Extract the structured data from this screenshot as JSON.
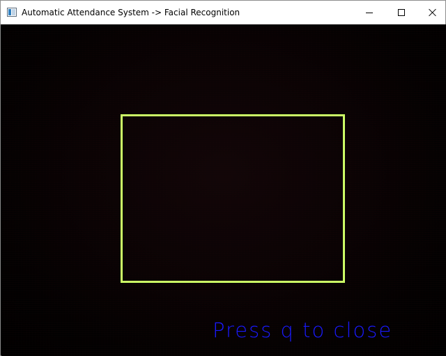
{
  "window": {
    "title": "Automatic Attendance System -> Facial Recognition",
    "icon": "app-window-icon",
    "controls": {
      "minimize_icon": "minimize-icon",
      "maximize_icon": "maximize-icon",
      "close_icon": "close-icon"
    }
  },
  "video": {
    "overlay_text": "Press q to close",
    "overlay_text_color": "#1a1aff",
    "detection_box_color": "#ccff66",
    "background_color": "#000000"
  }
}
